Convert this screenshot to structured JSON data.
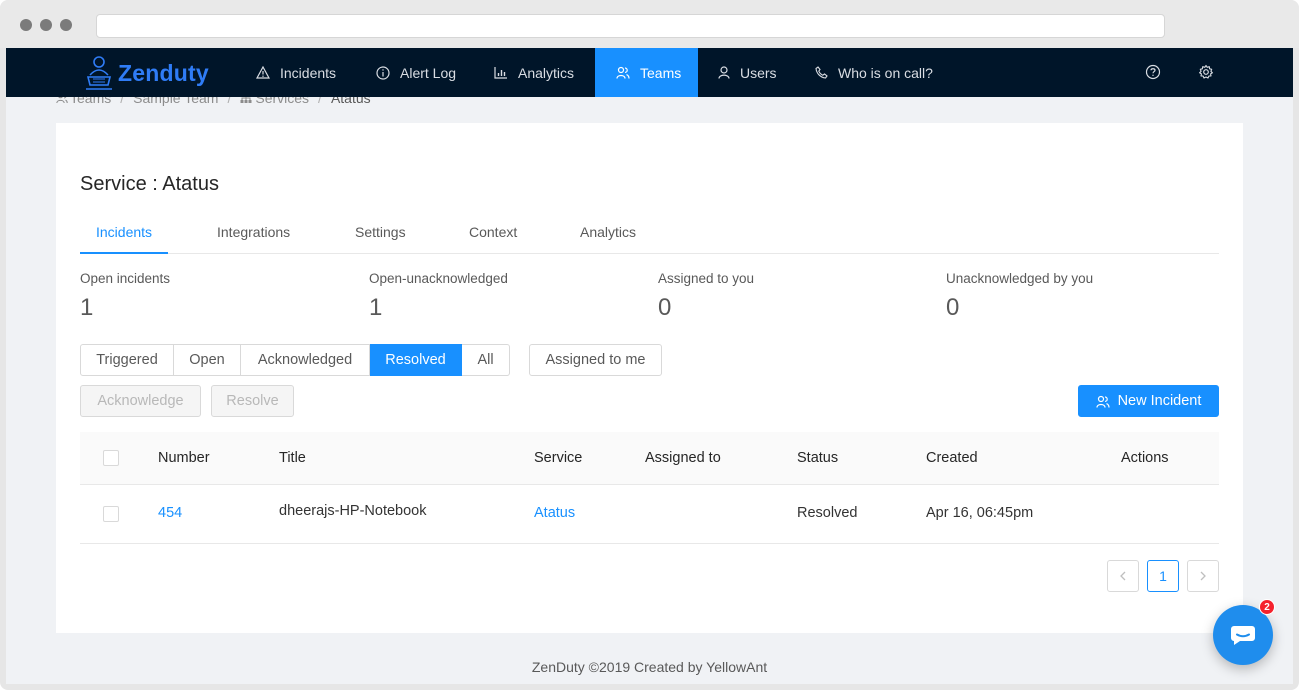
{
  "brand": {
    "name": "Zenduty"
  },
  "nav": {
    "items": [
      {
        "label": "Incidents",
        "icon": "warning-icon"
      },
      {
        "label": "Alert Log",
        "icon": "info-circle-icon"
      },
      {
        "label": "Analytics",
        "icon": "bar-chart-icon"
      },
      {
        "label": "Teams",
        "icon": "team-icon",
        "active": true
      },
      {
        "label": "Users",
        "icon": "user-icon"
      },
      {
        "label": "Who is on call?",
        "icon": "phone-icon"
      }
    ],
    "right_icons": [
      "help-icon",
      "settings-icon"
    ]
  },
  "breadcrumb": {
    "items": [
      "Teams",
      "Sample Team",
      "Services",
      "Atatus"
    ],
    "separator": "/"
  },
  "page": {
    "title": "Service : Atatus"
  },
  "tabs": [
    "Incidents",
    "Integrations",
    "Settings",
    "Context",
    "Analytics"
  ],
  "active_tab": "Incidents",
  "stats": [
    {
      "label": "Open incidents",
      "value": "1"
    },
    {
      "label": "Open-unacknowledged",
      "value": "1"
    },
    {
      "label": "Assigned to you",
      "value": "0"
    },
    {
      "label": "Unacknowledged by you",
      "value": "0"
    }
  ],
  "filters": {
    "status": [
      "Triggered",
      "Open",
      "Acknowledged",
      "Resolved",
      "All"
    ],
    "active": "Resolved",
    "assigned_label": "Assigned to me"
  },
  "actions": {
    "acknowledge": "Acknowledge",
    "resolve": "Resolve",
    "new_incident": "New Incident"
  },
  "table": {
    "columns": [
      "Number",
      "Title",
      "Service",
      "Assigned to",
      "Status",
      "Created",
      "Actions"
    ],
    "rows": [
      {
        "number": "454",
        "title": "dheerajs-HP-Notebook",
        "service": "Atatus",
        "assigned_to": "",
        "status": "Resolved",
        "created": "Apr 16, 06:45pm",
        "actions": ""
      }
    ]
  },
  "pagination": {
    "prev": "<",
    "current": "1",
    "next": ">"
  },
  "footer": {
    "text": "ZenDuty ©2019 Created by YellowAnt"
  },
  "chat_widget": {
    "badge": "2",
    "icon": "chat-icon"
  },
  "colors": {
    "nav_bg": "#001529",
    "primary": "#1890ff",
    "page_bg": "#f0f2f5"
  }
}
